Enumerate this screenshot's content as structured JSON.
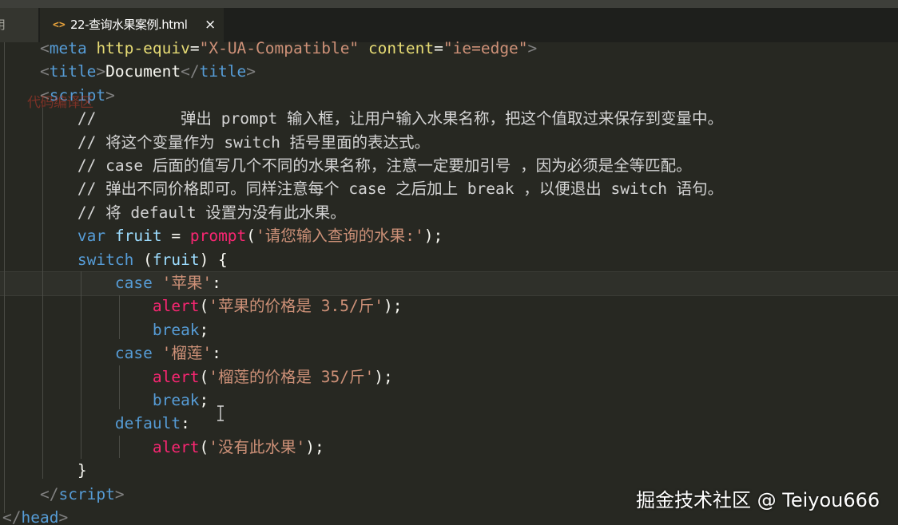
{
  "tabs": {
    "previous_tab_label": "用",
    "active_tab": {
      "icon": "html-file-icon",
      "label": "22-查询水果案例.html",
      "close_glyph": "×"
    }
  },
  "code": {
    "lines": [
      {
        "indent": "    ",
        "segments": [
          {
            "cls": "p",
            "text": "<"
          },
          {
            "cls": "t",
            "text": "meta"
          },
          {
            "cls": "tx",
            "text": " "
          },
          {
            "cls": "a",
            "text": "http-equiv"
          },
          {
            "cls": "tx",
            "text": "="
          },
          {
            "cls": "s",
            "text": "\"X-UA-Compatible\""
          },
          {
            "cls": "tx",
            "text": " "
          },
          {
            "cls": "a",
            "text": "content"
          },
          {
            "cls": "tx",
            "text": "="
          },
          {
            "cls": "s",
            "text": "\"ie=edge\""
          },
          {
            "cls": "p",
            "text": ">"
          }
        ]
      },
      {
        "indent": "    ",
        "segments": [
          {
            "cls": "p",
            "text": "<"
          },
          {
            "cls": "t",
            "text": "title"
          },
          {
            "cls": "p",
            "text": ">"
          },
          {
            "cls": "tx",
            "text": "Document"
          },
          {
            "cls": "p",
            "text": "</"
          },
          {
            "cls": "t",
            "text": "title"
          },
          {
            "cls": "p",
            "text": ">"
          }
        ]
      },
      {
        "indent": "    ",
        "segments": [
          {
            "cls": "p",
            "text": "<"
          },
          {
            "cls": "t",
            "text": "script"
          },
          {
            "cls": "p",
            "text": ">"
          }
        ]
      },
      {
        "indent": "        ",
        "segments": [
          {
            "cls": "c",
            "text": "//         弹出 prompt 输入框，让用户输入水果名称，把这个值取过来保存到变量中。"
          }
        ]
      },
      {
        "indent": "        ",
        "segments": [
          {
            "cls": "c",
            "text": "// 将这个变量作为 switch 括号里面的表达式。"
          }
        ]
      },
      {
        "indent": "        ",
        "segments": [
          {
            "cls": "c",
            "text": "// case 后面的值写几个不同的水果名称，注意一定要加引号 ，因为必须是全等匹配。"
          }
        ]
      },
      {
        "indent": "        ",
        "segments": [
          {
            "cls": "c",
            "text": "// 弹出不同价格即可。同样注意每个 case 之后加上 break ，以便退出 switch 语句。"
          }
        ]
      },
      {
        "indent": "        ",
        "segments": [
          {
            "cls": "c",
            "text": "// 将 default 设置为没有此水果。"
          }
        ]
      },
      {
        "indent": "        ",
        "segments": [
          {
            "cls": "k",
            "text": "var"
          },
          {
            "cls": "tx",
            "text": " "
          },
          {
            "cls": "v",
            "text": "fruit"
          },
          {
            "cls": "tx",
            "text": " = "
          },
          {
            "cls": "f",
            "text": "prompt"
          },
          {
            "cls": "tx",
            "text": "("
          },
          {
            "cls": "str",
            "text": "'请您输入查询的水果:'"
          },
          {
            "cls": "tx",
            "text": ");"
          }
        ]
      },
      {
        "indent": "        ",
        "segments": [
          {
            "cls": "k",
            "text": "switch"
          },
          {
            "cls": "tx",
            "text": " ("
          },
          {
            "cls": "v",
            "text": "fruit"
          },
          {
            "cls": "tx",
            "text": ") {"
          }
        ]
      },
      {
        "indent": "            ",
        "segments": [
          {
            "cls": "k",
            "text": "case"
          },
          {
            "cls": "tx",
            "text": " "
          },
          {
            "cls": "str",
            "text": "'苹果'"
          },
          {
            "cls": "tx",
            "text": ":"
          }
        ]
      },
      {
        "indent": "                ",
        "segments": [
          {
            "cls": "f",
            "text": "alert"
          },
          {
            "cls": "tx",
            "text": "("
          },
          {
            "cls": "str",
            "text": "'苹果的价格是 3.5/斤'"
          },
          {
            "cls": "tx",
            "text": ");"
          }
        ]
      },
      {
        "indent": "                ",
        "segments": [
          {
            "cls": "k",
            "text": "break"
          },
          {
            "cls": "tx",
            "text": ";"
          }
        ]
      },
      {
        "indent": "            ",
        "segments": [
          {
            "cls": "k",
            "text": "case"
          },
          {
            "cls": "tx",
            "text": " "
          },
          {
            "cls": "str",
            "text": "'榴莲'"
          },
          {
            "cls": "tx",
            "text": ":"
          }
        ]
      },
      {
        "indent": "                ",
        "segments": [
          {
            "cls": "f",
            "text": "alert"
          },
          {
            "cls": "tx",
            "text": "("
          },
          {
            "cls": "str",
            "text": "'榴莲的价格是 35/斤'"
          },
          {
            "cls": "tx",
            "text": ");"
          }
        ]
      },
      {
        "indent": "                ",
        "segments": [
          {
            "cls": "k",
            "text": "break"
          },
          {
            "cls": "tx",
            "text": ";"
          }
        ]
      },
      {
        "indent": "            ",
        "segments": [
          {
            "cls": "k",
            "text": "default"
          },
          {
            "cls": "tx",
            "text": ":"
          }
        ]
      },
      {
        "indent": "                ",
        "segments": [
          {
            "cls": "f",
            "text": "alert"
          },
          {
            "cls": "tx",
            "text": "("
          },
          {
            "cls": "str",
            "text": "'没有此水果'"
          },
          {
            "cls": "tx",
            "text": ");"
          }
        ]
      },
      {
        "indent": "        ",
        "segments": [
          {
            "cls": "tx",
            "text": "}"
          }
        ]
      },
      {
        "indent": "    ",
        "segments": [
          {
            "cls": "p",
            "text": "</"
          },
          {
            "cls": "t",
            "text": "script"
          },
          {
            "cls": "p",
            "text": ">"
          }
        ]
      },
      {
        "indent": "",
        "segments": [
          {
            "cls": "p",
            "text": "</"
          },
          {
            "cls": "t",
            "text": "head"
          },
          {
            "cls": "p",
            "text": ">"
          }
        ]
      }
    ]
  },
  "overlay_note": "代码编译区",
  "watermark": "掘金技术社区 @ Teiyou666",
  "colors": {
    "editor_background": "#272822",
    "tag": "#569cd6",
    "attribute": "#e6db74",
    "string": "#ce9178",
    "function": "#f92672",
    "variable": "#9cdcfe"
  }
}
